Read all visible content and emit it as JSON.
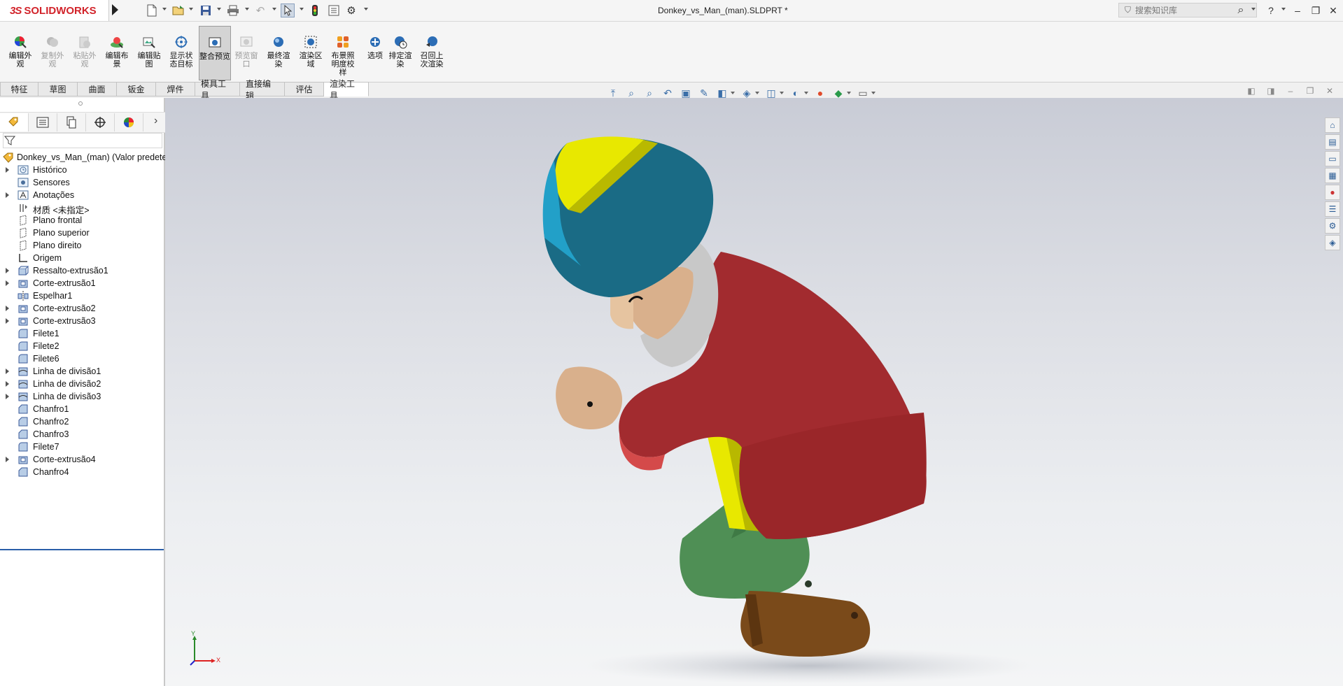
{
  "app": {
    "brand_prefix": "3S",
    "brand_name": "SOLIDWORKS",
    "document_title": "Donkey_vs_Man_(man).SLDPRT *"
  },
  "quick_access": {
    "icons": [
      "new-document-icon",
      "open-icon",
      "save-icon",
      "print-icon",
      "undo-icon",
      "select-pointer-icon",
      "rebuild-icon",
      "file-properties-icon",
      "options-gear-icon"
    ]
  },
  "search": {
    "placeholder": "搜索知识库"
  },
  "window_controls": {
    "help": "?",
    "minimize": "–",
    "restore": "❐",
    "close": "✕"
  },
  "command_manager": {
    "commands": [
      {
        "label": "编辑外观",
        "icon": "edit-appearance-icon",
        "enabled": true
      },
      {
        "label": "复制外观",
        "icon": "copy-appearance-icon",
        "enabled": false
      },
      {
        "label": "粘贴外观",
        "icon": "paste-appearance-icon",
        "enabled": false
      },
      {
        "label": "编辑布景",
        "icon": "edit-scene-icon",
        "enabled": true
      },
      {
        "label": "编辑贴图",
        "icon": "edit-decal-icon",
        "enabled": true
      },
      {
        "label": "显示状态目标",
        "icon": "display-state-target-icon",
        "enabled": true
      },
      {
        "label": "整合预览",
        "icon": "integrated-preview-icon",
        "enabled": true,
        "active": true
      },
      {
        "label": "预览窗口",
        "icon": "preview-window-icon",
        "enabled": false
      },
      {
        "label": "最终渲染",
        "icon": "final-render-icon",
        "enabled": true
      },
      {
        "label": "渲染区域",
        "icon": "render-region-icon",
        "enabled": true
      },
      {
        "label": "布景照明度校样",
        "icon": "scene-illumination-proof-icon",
        "enabled": true
      },
      {
        "label": "选项",
        "icon": "render-options-icon",
        "enabled": true
      },
      {
        "label": "排定渲染",
        "icon": "schedule-render-icon",
        "enabled": true
      },
      {
        "label": "召回上次渲染",
        "icon": "recall-last-render-icon",
        "enabled": true
      }
    ]
  },
  "tabs": [
    "特征",
    "草图",
    "曲面",
    "钣金",
    "焊件",
    "模具工具",
    "直接编辑",
    "评估",
    "渲染工具"
  ],
  "active_tab": "渲染工具",
  "feature_tree": {
    "root": "Donkey_vs_Man_(man)  (Valor predeterminado)",
    "items": [
      {
        "label": "Histórico",
        "icon": "history-icon",
        "expandable": true
      },
      {
        "label": "Sensores",
        "icon": "sensors-icon",
        "expandable": false
      },
      {
        "label": "Anotações",
        "icon": "annotations-icon",
        "expandable": true
      },
      {
        "label": "材质 <未指定>",
        "icon": "material-icon",
        "expandable": false
      },
      {
        "label": "Plano frontal",
        "icon": "plane-icon",
        "expandable": false
      },
      {
        "label": "Plano superior",
        "icon": "plane-icon",
        "expandable": false
      },
      {
        "label": "Plano direito",
        "icon": "plane-icon",
        "expandable": false
      },
      {
        "label": "Origem",
        "icon": "origin-icon",
        "expandable": false
      },
      {
        "label": "Ressalto-extrusão1",
        "icon": "extrude-boss-icon",
        "expandable": true
      },
      {
        "label": "Corte-extrusão1",
        "icon": "extrude-cut-icon",
        "expandable": true
      },
      {
        "label": "Espelhar1",
        "icon": "mirror-icon",
        "expandable": false
      },
      {
        "label": "Corte-extrusão2",
        "icon": "extrude-cut-icon",
        "expandable": true
      },
      {
        "label": "Corte-extrusão3",
        "icon": "extrude-cut-icon",
        "expandable": true
      },
      {
        "label": "Filete1",
        "icon": "fillet-icon",
        "expandable": false
      },
      {
        "label": "Filete2",
        "icon": "fillet-icon",
        "expandable": false
      },
      {
        "label": "Filete6",
        "icon": "fillet-icon",
        "expandable": false
      },
      {
        "label": "Linha de divisão1",
        "icon": "split-line-icon",
        "expandable": true
      },
      {
        "label": "Linha de divisão2",
        "icon": "split-line-icon",
        "expandable": true
      },
      {
        "label": "Linha de divisão3",
        "icon": "split-line-icon",
        "expandable": true
      },
      {
        "label": "Chanfro1",
        "icon": "chamfer-icon",
        "expandable": false
      },
      {
        "label": "Chanfro2",
        "icon": "chamfer-icon",
        "expandable": false
      },
      {
        "label": "Chanfro3",
        "icon": "chamfer-icon",
        "expandable": false
      },
      {
        "label": "Filete7",
        "icon": "fillet-icon",
        "expandable": false
      },
      {
        "label": "Corte-extrusão4",
        "icon": "extrude-cut-icon",
        "expandable": true
      },
      {
        "label": "Chanfro4",
        "icon": "chamfer-icon",
        "expandable": false
      }
    ]
  },
  "triad": {
    "x": "X",
    "y": "Y"
  },
  "colors": {
    "brand": "#d2232a",
    "hat_teal": "#1a6b85",
    "hat_yellow": "#ffff00",
    "shirt_red": "#a22b2f",
    "pants_green": "#4f8f55",
    "shoes_brown": "#7a4a1a",
    "skin": "#d9b08c",
    "beard": "#c8c8c8"
  }
}
